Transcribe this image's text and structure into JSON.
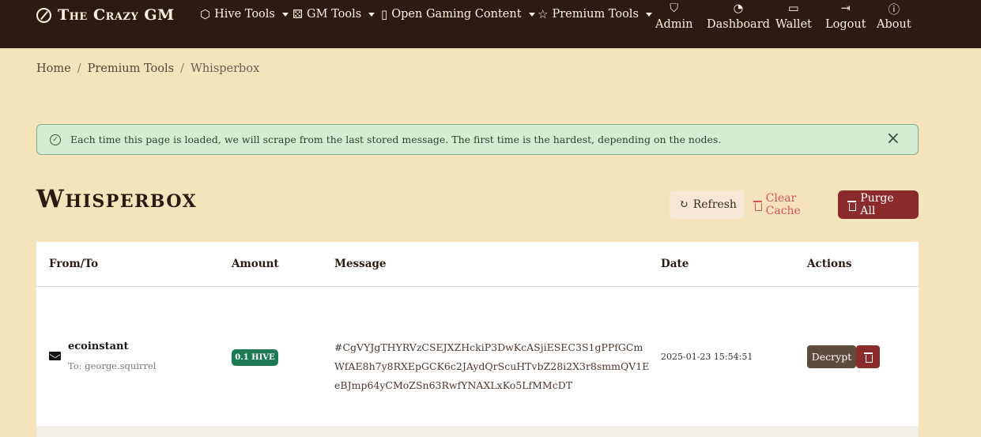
{
  "brand": {
    "name": "The Crazy GM",
    "icon": "compass-icon"
  },
  "nav": {
    "dropdowns": [
      {
        "label": "Hive Tools",
        "icon": "hexagon-icon"
      },
      {
        "label": "GM Tools",
        "icon": "dice-icon"
      },
      {
        "label": "Open Gaming Content",
        "icon": "journal-icon"
      },
      {
        "label": "Premium Tools",
        "icon": "star-icon"
      }
    ],
    "items": [
      {
        "label": "Admin",
        "icon": "shield-icon"
      },
      {
        "label": "Dashboard",
        "icon": "speedometer-icon"
      },
      {
        "label": "Wallet",
        "icon": "wallet-icon"
      },
      {
        "label": "Logout",
        "icon": "logout-icon"
      },
      {
        "label": "About",
        "icon": "info-icon"
      }
    ]
  },
  "breadcrumb": {
    "home": "Home",
    "parent": "Premium Tools",
    "current": "Whisperbox",
    "separator": "/"
  },
  "alert": {
    "message": "Each time this page is loaded, we will scrape from the last stored message. The first time is the hardest, depending on the nodes.",
    "close": "×"
  },
  "page": {
    "title": "Whisperbox"
  },
  "actions": {
    "refresh": "Refresh",
    "clear_cache": "Clear Cache",
    "purge_all": "Purge All"
  },
  "table": {
    "headers": {
      "from_to": "From/To",
      "amount": "Amount",
      "message": "Message",
      "date": "Date",
      "actions": "Actions"
    },
    "rows": [
      {
        "from": "ecoinstant",
        "to": "To: george.squirrel",
        "amount": "0.1 HIVE",
        "message": "#CgVYJgTHYRVzCSEJXZHckiP3DwKcASjiESEC3S1gPPfGCmWfAE8h7y8RXEpGCK6c2JAydQrScuHTvbZ28i2X3r8smmQV1EeBJmp64yCMoZSn63RwfYNAXLxKo5LfMMcDT",
        "date": "2025-01-23 15:54:51",
        "decrypt": "Decrypt"
      }
    ]
  },
  "colors": {
    "navbar": "#2d1a12",
    "background": "#f4e3bb",
    "purge": "#8a2a2a",
    "badge": "#1d7a52",
    "alert": "#d6ebd3"
  }
}
